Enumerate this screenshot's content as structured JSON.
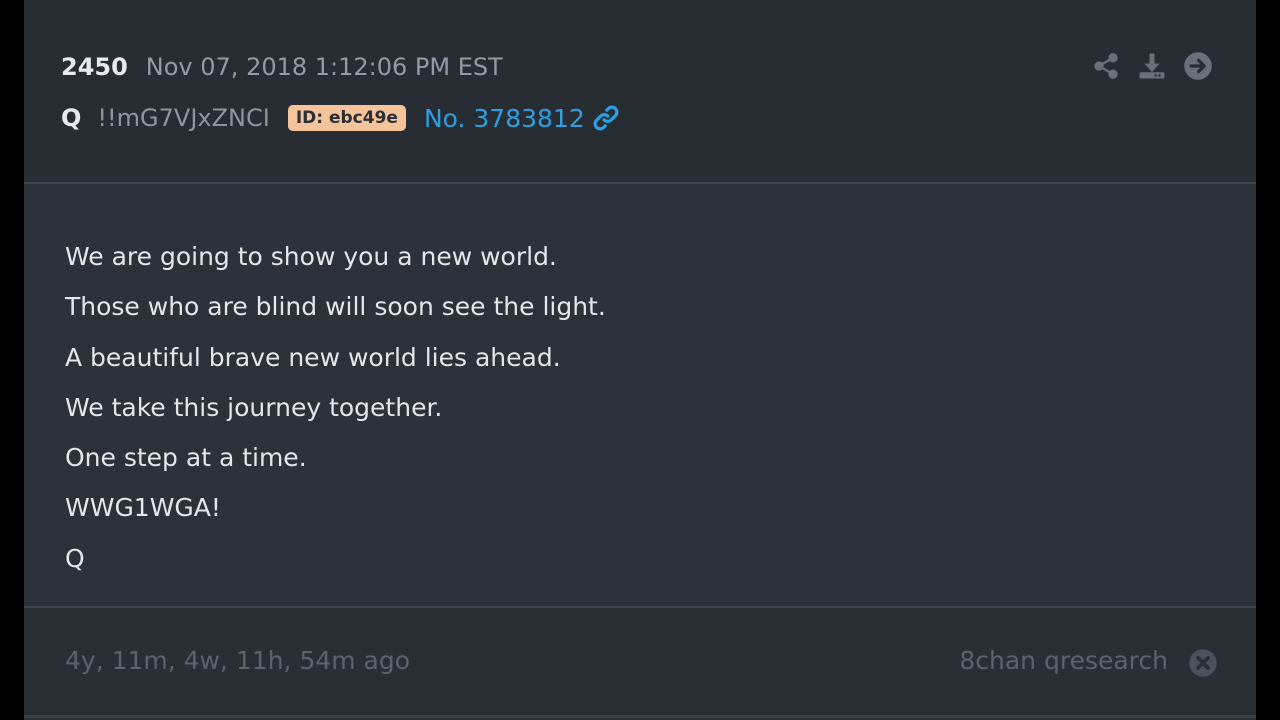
{
  "post": {
    "number": "2450",
    "timestamp": "Nov 07, 2018 1:12:06 PM EST",
    "author": "Q",
    "tripcode": "!!mG7VJxZNCI",
    "id_badge": "ID: ebc49e",
    "post_no": "No. 3783812"
  },
  "actions": {
    "share_icon": "share-icon",
    "download_icon": "download-icon",
    "forward_icon": "arrow-circle-right-icon"
  },
  "body": {
    "lines": [
      "We are going to show you a new world.",
      "Those who are blind will soon see the light.",
      "A beautiful brave new world lies ahead.",
      "We take this journey together.",
      "One step at a time.",
      "WWG1WGA!",
      "Q"
    ]
  },
  "footer": {
    "ago": "4y, 11m, 4w, 11h, 54m ago",
    "source": "8chan qresearch",
    "close_icon": "close-circle-icon"
  },
  "colors": {
    "background": "#2b2f37",
    "link": "#2e9fe0",
    "badge": "#f5c49a",
    "muted": "#5d636d"
  }
}
